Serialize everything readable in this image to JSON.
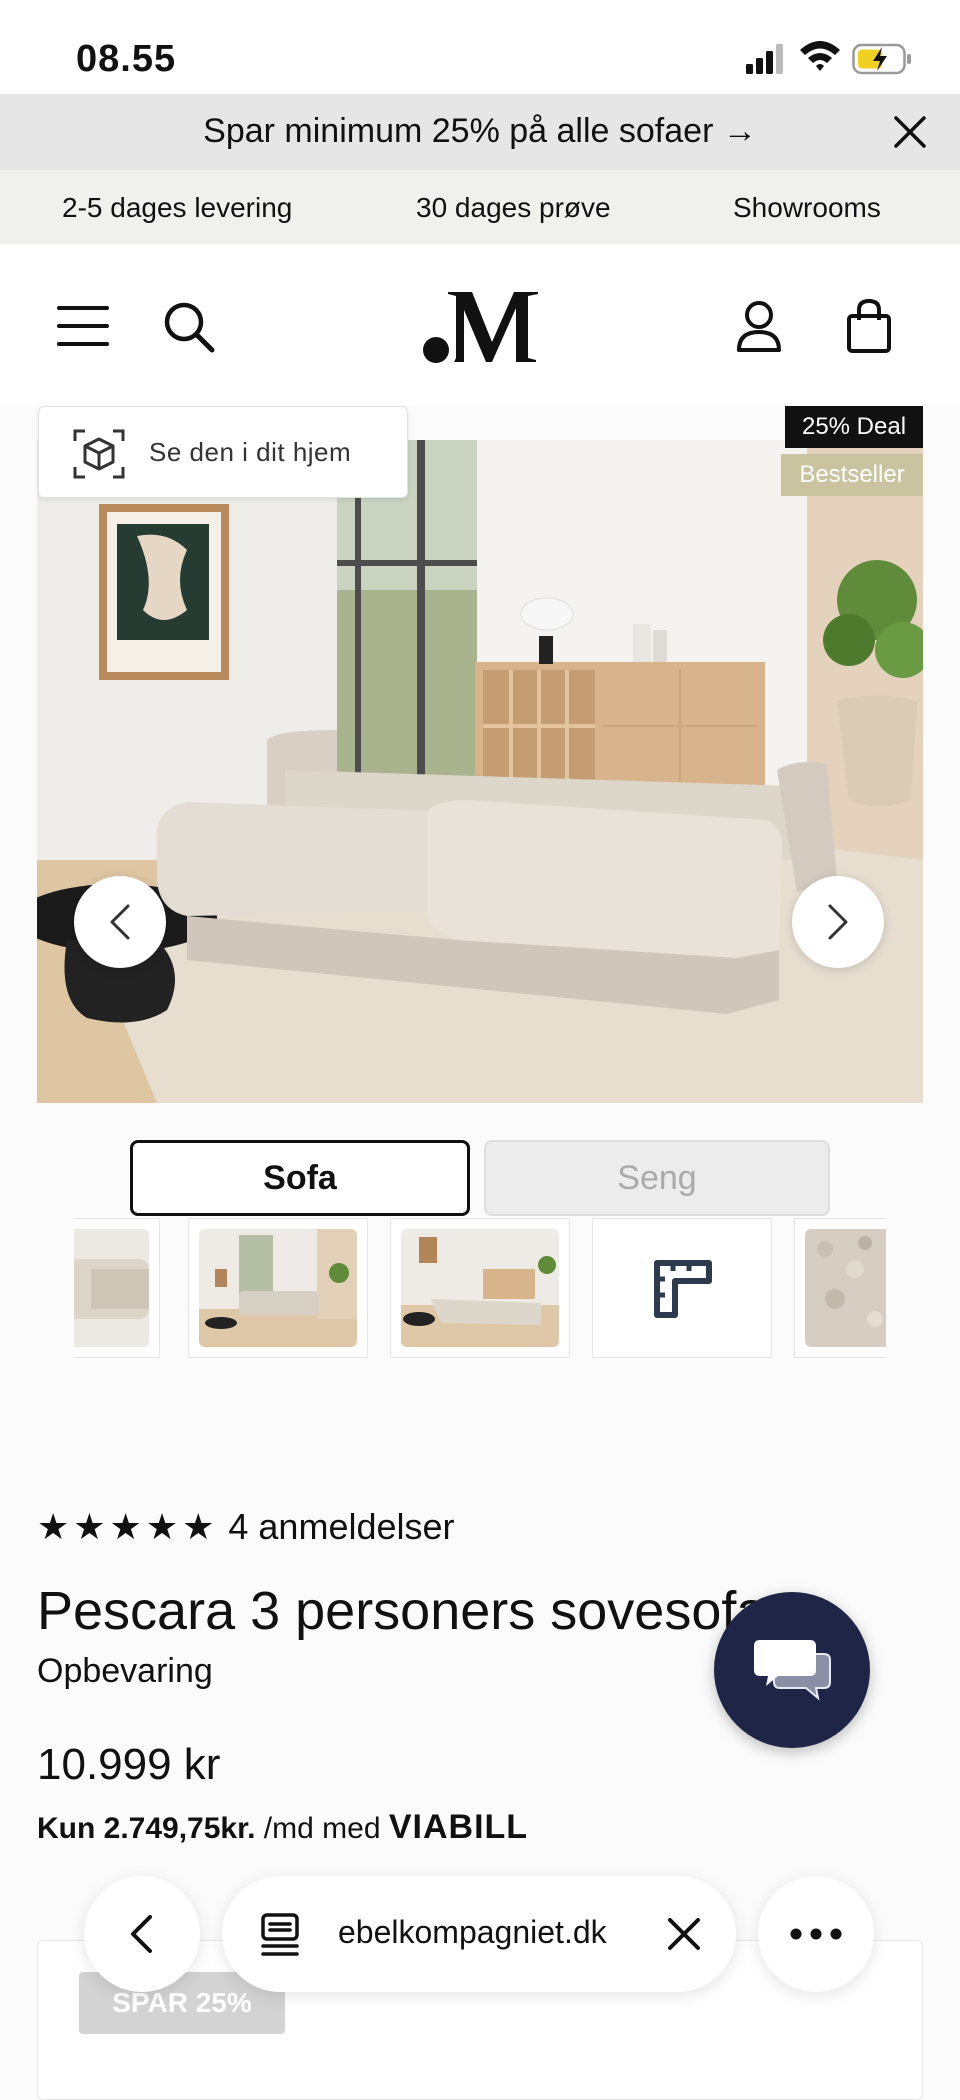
{
  "status_bar": {
    "time": "08.55"
  },
  "promo": {
    "text": "Spar minimum 25% på alle sofaer →"
  },
  "usp": {
    "delivery": "2-5 dages levering",
    "trial": "30 dages prøve",
    "showrooms": "Showrooms"
  },
  "header": {
    "logo": ".M"
  },
  "hero": {
    "ar_label": "Se den i dit hjem",
    "deal_badge": "25% Deal",
    "bestseller_badge": "Bestseller"
  },
  "toggle": {
    "sofa": "Sofa",
    "seng": "Seng",
    "selected": "Sofa"
  },
  "thumbnails": [
    "sofa-side",
    "living-room-sofa",
    "living-room-bed",
    "dimensions-icon",
    "fabric-texture"
  ],
  "product": {
    "stars": "★★★★★",
    "reviews": "4 anmeldelser",
    "title": "Pescara 3 personers sovesofa",
    "subtitle": "Opbevaring",
    "price": "10.999 kr",
    "finance_amount": "Kun 2.749,75kr.",
    "finance_text": " /md med ",
    "finance_brand": "VIABILL"
  },
  "card": {
    "badge": "SPAR 25%"
  },
  "browser": {
    "url": "ebelkompagniet.dk"
  },
  "colors": {
    "accent_badge": "#c9c39f",
    "chat": "#1f2547",
    "deal": "#111111"
  }
}
